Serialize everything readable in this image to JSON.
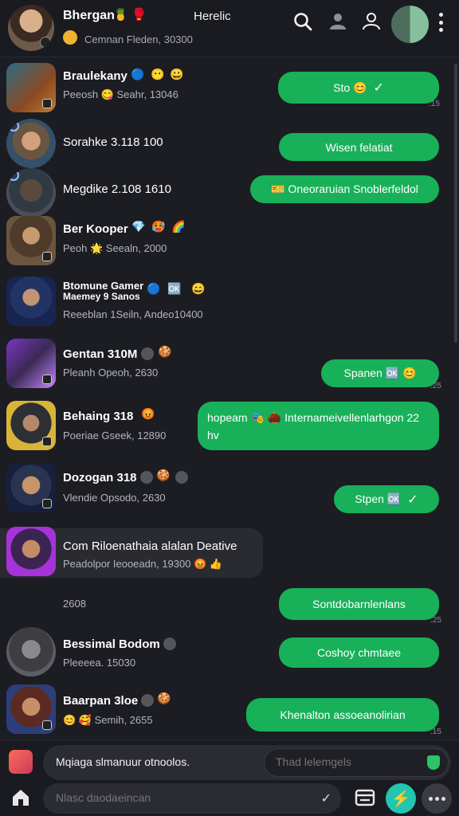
{
  "header": {
    "title": "Bhergan",
    "title_emojis": [
      "🍍",
      "🥊"
    ],
    "center_text": "Herelic",
    "subtitle": "Cemnan  Fleden, 30300",
    "icons": [
      "search-icon",
      "person-icon",
      "profile-icon",
      "status-circle",
      "kebab-menu-icon"
    ]
  },
  "chats": [
    {
      "name": "Braulekany",
      "name_emojis": [
        "🔵",
        "😶",
        "😀"
      ],
      "sub": "Peeosh 😋 Seahr, 13046",
      "bubble": "Sto 😊",
      "check": "✓",
      "tiny": ".15"
    },
    {
      "name": "Sorahke 3.118 100",
      "sub": "",
      "bubble": "Wisen felatiat",
      "check": ""
    },
    {
      "name": "Megdike 2.108 1610",
      "sub": "",
      "bubble": "🎫 Oneoraruian Snoblerfeldol",
      "check": ""
    },
    {
      "name": "Ber Kooper",
      "name_emojis": [
        "💎",
        "🥵",
        "🌈"
      ],
      "sub": "Peoh 🌟 Seealn, 2000",
      "bubble": "",
      "check": ""
    },
    {
      "name": "Btomune Gamer",
      "name2": "Maemey 9 Sanos",
      "name_emojis": [
        "🔵",
        "🆗",
        "😄"
      ],
      "sub": "Reeeblan 1Seiln, Andeo10400",
      "bubble": "",
      "check": ""
    },
    {
      "name": "Gentan 310M",
      "name_emojis": [
        "🌑",
        "🍪"
      ],
      "sub": "Pleanh Opeoh, 2630",
      "bubble": "Spanen 🆗 😊",
      "check": "",
      "tiny": ".25"
    },
    {
      "name": "Behaing 318",
      "name_emojis": [
        "😡"
      ],
      "sub": "Poeriae Gseek, 12890",
      "bubble": "hopeam 🎭 🌰 Internameivellenlarhgon 22 hv",
      "check": ""
    },
    {
      "name": "Dozogan 318",
      "name_emojis": [
        "🌑",
        "🍪",
        "🌑"
      ],
      "sub": "Vlendie Opsodo, 2630",
      "bubble": "Stpen 🆗",
      "check": "✓"
    },
    {
      "name": "Com Riloenathaia alalan Deative",
      "sub": "Peadolpor  Ieooeadn, 19300 😡 👍",
      "bubble": "",
      "check": ""
    },
    {
      "name": "",
      "sub": "2608",
      "bubble": "Sontdobarnlenlans",
      "check": "",
      "tiny": ".25"
    },
    {
      "name": "Bessimal Bodom",
      "name_emojis": [
        "🌑"
      ],
      "sub": "Pleeeea. 15030",
      "bubble": "Coshoy chmtaee",
      "check": ""
    },
    {
      "name": "Baarpan 3loe",
      "name_emojis": [
        "🌑",
        "🍪"
      ],
      "sub": "😊 🥰  Semih, 2655",
      "bubble": "Khenalton assoeanolirian",
      "check": "",
      "tiny": ".15"
    }
  ],
  "composer": {
    "message": "Mqiaga slmanuur otnoolos.",
    "placeholder": "Thad lelemgels"
  },
  "bottom": {
    "search_placeholder": "Nlasc daodaeincan",
    "chevron": "✓",
    "fab_icon": "⚡"
  }
}
